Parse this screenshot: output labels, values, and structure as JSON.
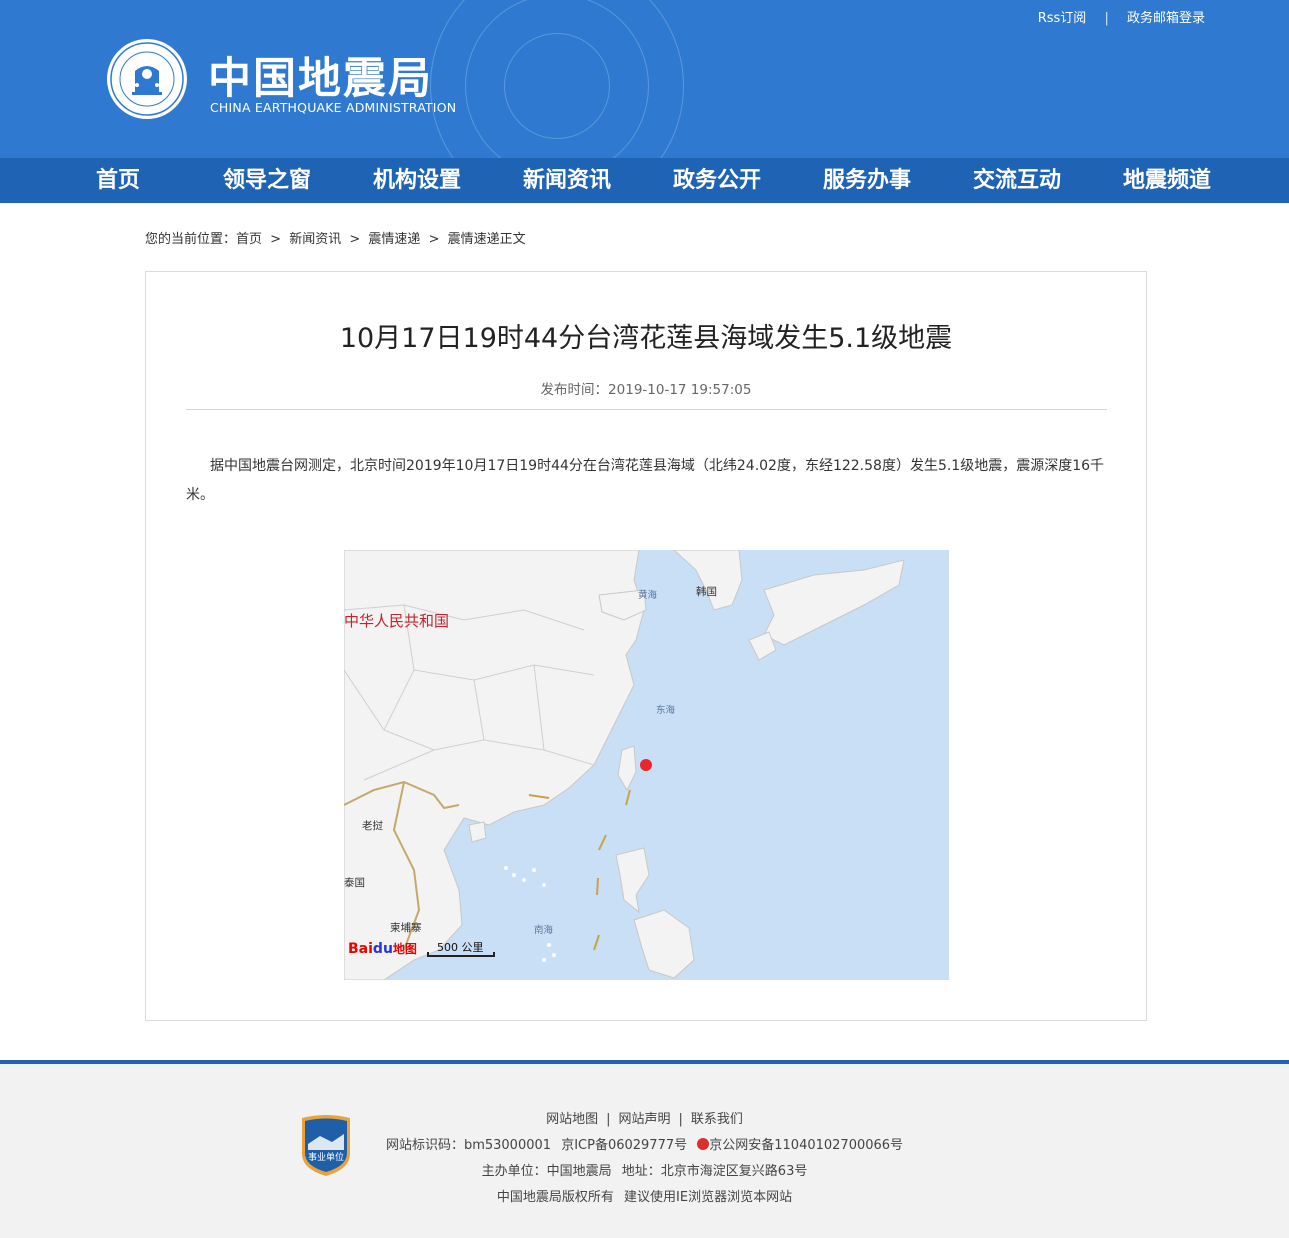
{
  "header": {
    "rss_label": "Rss订阅",
    "mail_label": "政务邮箱登录",
    "logo_cn": "中国地震局",
    "logo_en": "CHINA EARTHQUAKE ADMINISTRATION",
    "emblem_text": "CHINA EARTHQUAKE ADMINISTRATION",
    "emblem_bottom_text": "中国地震局"
  },
  "nav": {
    "items": [
      {
        "label": "首页"
      },
      {
        "label": "领导之窗"
      },
      {
        "label": "机构设置"
      },
      {
        "label": "新闻资讯"
      },
      {
        "label": "政务公开"
      },
      {
        "label": "服务办事"
      },
      {
        "label": "交流互动"
      },
      {
        "label": "地震频道"
      }
    ]
  },
  "breadcrumb": {
    "prefix": "您的当前位置：",
    "items": [
      "首页",
      "新闻资讯",
      "震情速递",
      "震情速递正文"
    ],
    "separator": ">"
  },
  "article": {
    "title": "10月17日19时44分台湾花莲县海域发生5.1级地震",
    "date_label": "发布时间：",
    "date": "2019-10-17 19:57:05",
    "body": "据中国地震台网测定，北京时间2019年10月17日19时44分在台湾花莲县海域（北纬24.02度，东经122.58度）发生5.1级地震，震源深度16千米。"
  },
  "map": {
    "labels": {
      "china": "中华人民共和国",
      "korea": "韩国",
      "yellow_sea": "黄海",
      "east_sea": "东海",
      "laos": "老挝",
      "thailand": "泰国",
      "cambodia": "柬埔寨",
      "south_sea": "南海"
    },
    "scale_label": "500 公里",
    "provider_bai": "Bai",
    "provider_du": "du",
    "provider_map": "地图",
    "epicenter_color": "#e8262b",
    "land_color": "#f3f3f3",
    "water_color": "#c9dff6"
  },
  "footer": {
    "links": [
      "网站地图",
      "网站声明",
      "联系我们"
    ],
    "line2_id": "网站标识码：bm53000001",
    "line2_icp": "京ICP备06029777号",
    "line2_police": "京公网安备11040102700066号",
    "line3_host": "主办单位：中国地震局",
    "line3_addr": "地址：北京市海淀区复兴路63号",
    "line4_copy": "中国地震局版权所有",
    "line4_browser": "建议使用IE浏览器浏览本网站",
    "badge_label": "事业单位"
  }
}
